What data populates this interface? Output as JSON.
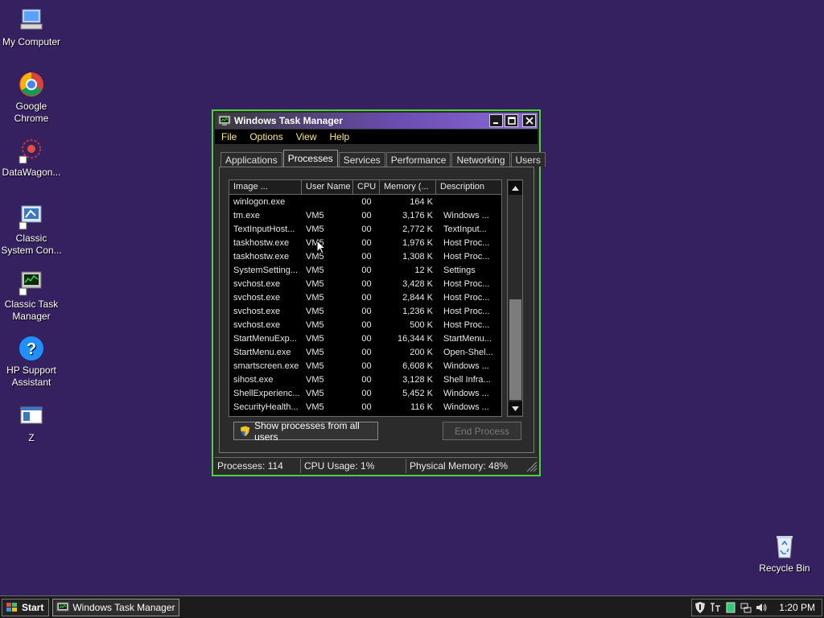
{
  "desktop": {
    "icons": [
      {
        "label": "My Computer"
      },
      {
        "label": "Google Chrome"
      },
      {
        "label": "DataWagon..."
      },
      {
        "label": "Classic System Con..."
      },
      {
        "label": "Classic Task Manager"
      },
      {
        "label": "HP Support Assistant"
      },
      {
        "label": "Z"
      },
      {
        "label": "Recycle Bin"
      }
    ]
  },
  "window": {
    "title": "Windows Task Manager",
    "menu": [
      "File",
      "Options",
      "View",
      "Help"
    ],
    "tabs": [
      "Applications",
      "Processes",
      "Services",
      "Performance",
      "Networking",
      "Users"
    ],
    "active_tab": "Processes",
    "columns": [
      "Image ...",
      "User Name",
      "CPU",
      "Memory (...",
      "Description"
    ],
    "rows": [
      {
        "image": "winlogon.exe",
        "user": "",
        "cpu": "00",
        "mem": "164 K",
        "desc": ""
      },
      {
        "image": "tm.exe",
        "user": "VM5",
        "cpu": "00",
        "mem": "3,176 K",
        "desc": "Windows ..."
      },
      {
        "image": "TextInputHost...",
        "user": "VM5",
        "cpu": "00",
        "mem": "2,772 K",
        "desc": "TextInput..."
      },
      {
        "image": "taskhostw.exe",
        "user": "VM5",
        "cpu": "00",
        "mem": "1,976 K",
        "desc": "Host Proc..."
      },
      {
        "image": "taskhostw.exe",
        "user": "VM5",
        "cpu": "00",
        "mem": "1,308 K",
        "desc": "Host Proc..."
      },
      {
        "image": "SystemSetting...",
        "user": "VM5",
        "cpu": "00",
        "mem": "12 K",
        "desc": "Settings"
      },
      {
        "image": "svchost.exe",
        "user": "VM5",
        "cpu": "00",
        "mem": "3,428 K",
        "desc": "Host Proc..."
      },
      {
        "image": "svchost.exe",
        "user": "VM5",
        "cpu": "00",
        "mem": "2,844 K",
        "desc": "Host Proc..."
      },
      {
        "image": "svchost.exe",
        "user": "VM5",
        "cpu": "00",
        "mem": "1,236 K",
        "desc": "Host Proc..."
      },
      {
        "image": "svchost.exe",
        "user": "VM5",
        "cpu": "00",
        "mem": "500 K",
        "desc": "Host Proc..."
      },
      {
        "image": "StartMenuExp...",
        "user": "VM5",
        "cpu": "00",
        "mem": "16,344 K",
        "desc": "StartMenu..."
      },
      {
        "image": "StartMenu.exe",
        "user": "VM5",
        "cpu": "00",
        "mem": "200 K",
        "desc": "Open-Shel..."
      },
      {
        "image": "smartscreen.exe",
        "user": "VM5",
        "cpu": "00",
        "mem": "6,608 K",
        "desc": "Windows ..."
      },
      {
        "image": "sihost.exe",
        "user": "VM5",
        "cpu": "00",
        "mem": "3,128 K",
        "desc": "Shell Infra..."
      },
      {
        "image": "ShellExperienc...",
        "user": "VM5",
        "cpu": "00",
        "mem": "5,452 K",
        "desc": "Windows ..."
      },
      {
        "image": "SecurityHealth...",
        "user": "VM5",
        "cpu": "00",
        "mem": "116 K",
        "desc": "Windows ..."
      }
    ],
    "show_all_label": "Show processes from all users",
    "end_process_label": "End Process",
    "status": {
      "processes": "Processes: 114",
      "cpu": "CPU Usage: 1%",
      "memory": "Physical Memory: 48%"
    }
  },
  "taskbar": {
    "start_label": "Start",
    "task_label": "Windows Task Manager",
    "clock": "1:20 PM"
  },
  "colors": {
    "desktop": "#35215f",
    "window_border": "#4cd137",
    "menu_text": "#ffe680"
  }
}
